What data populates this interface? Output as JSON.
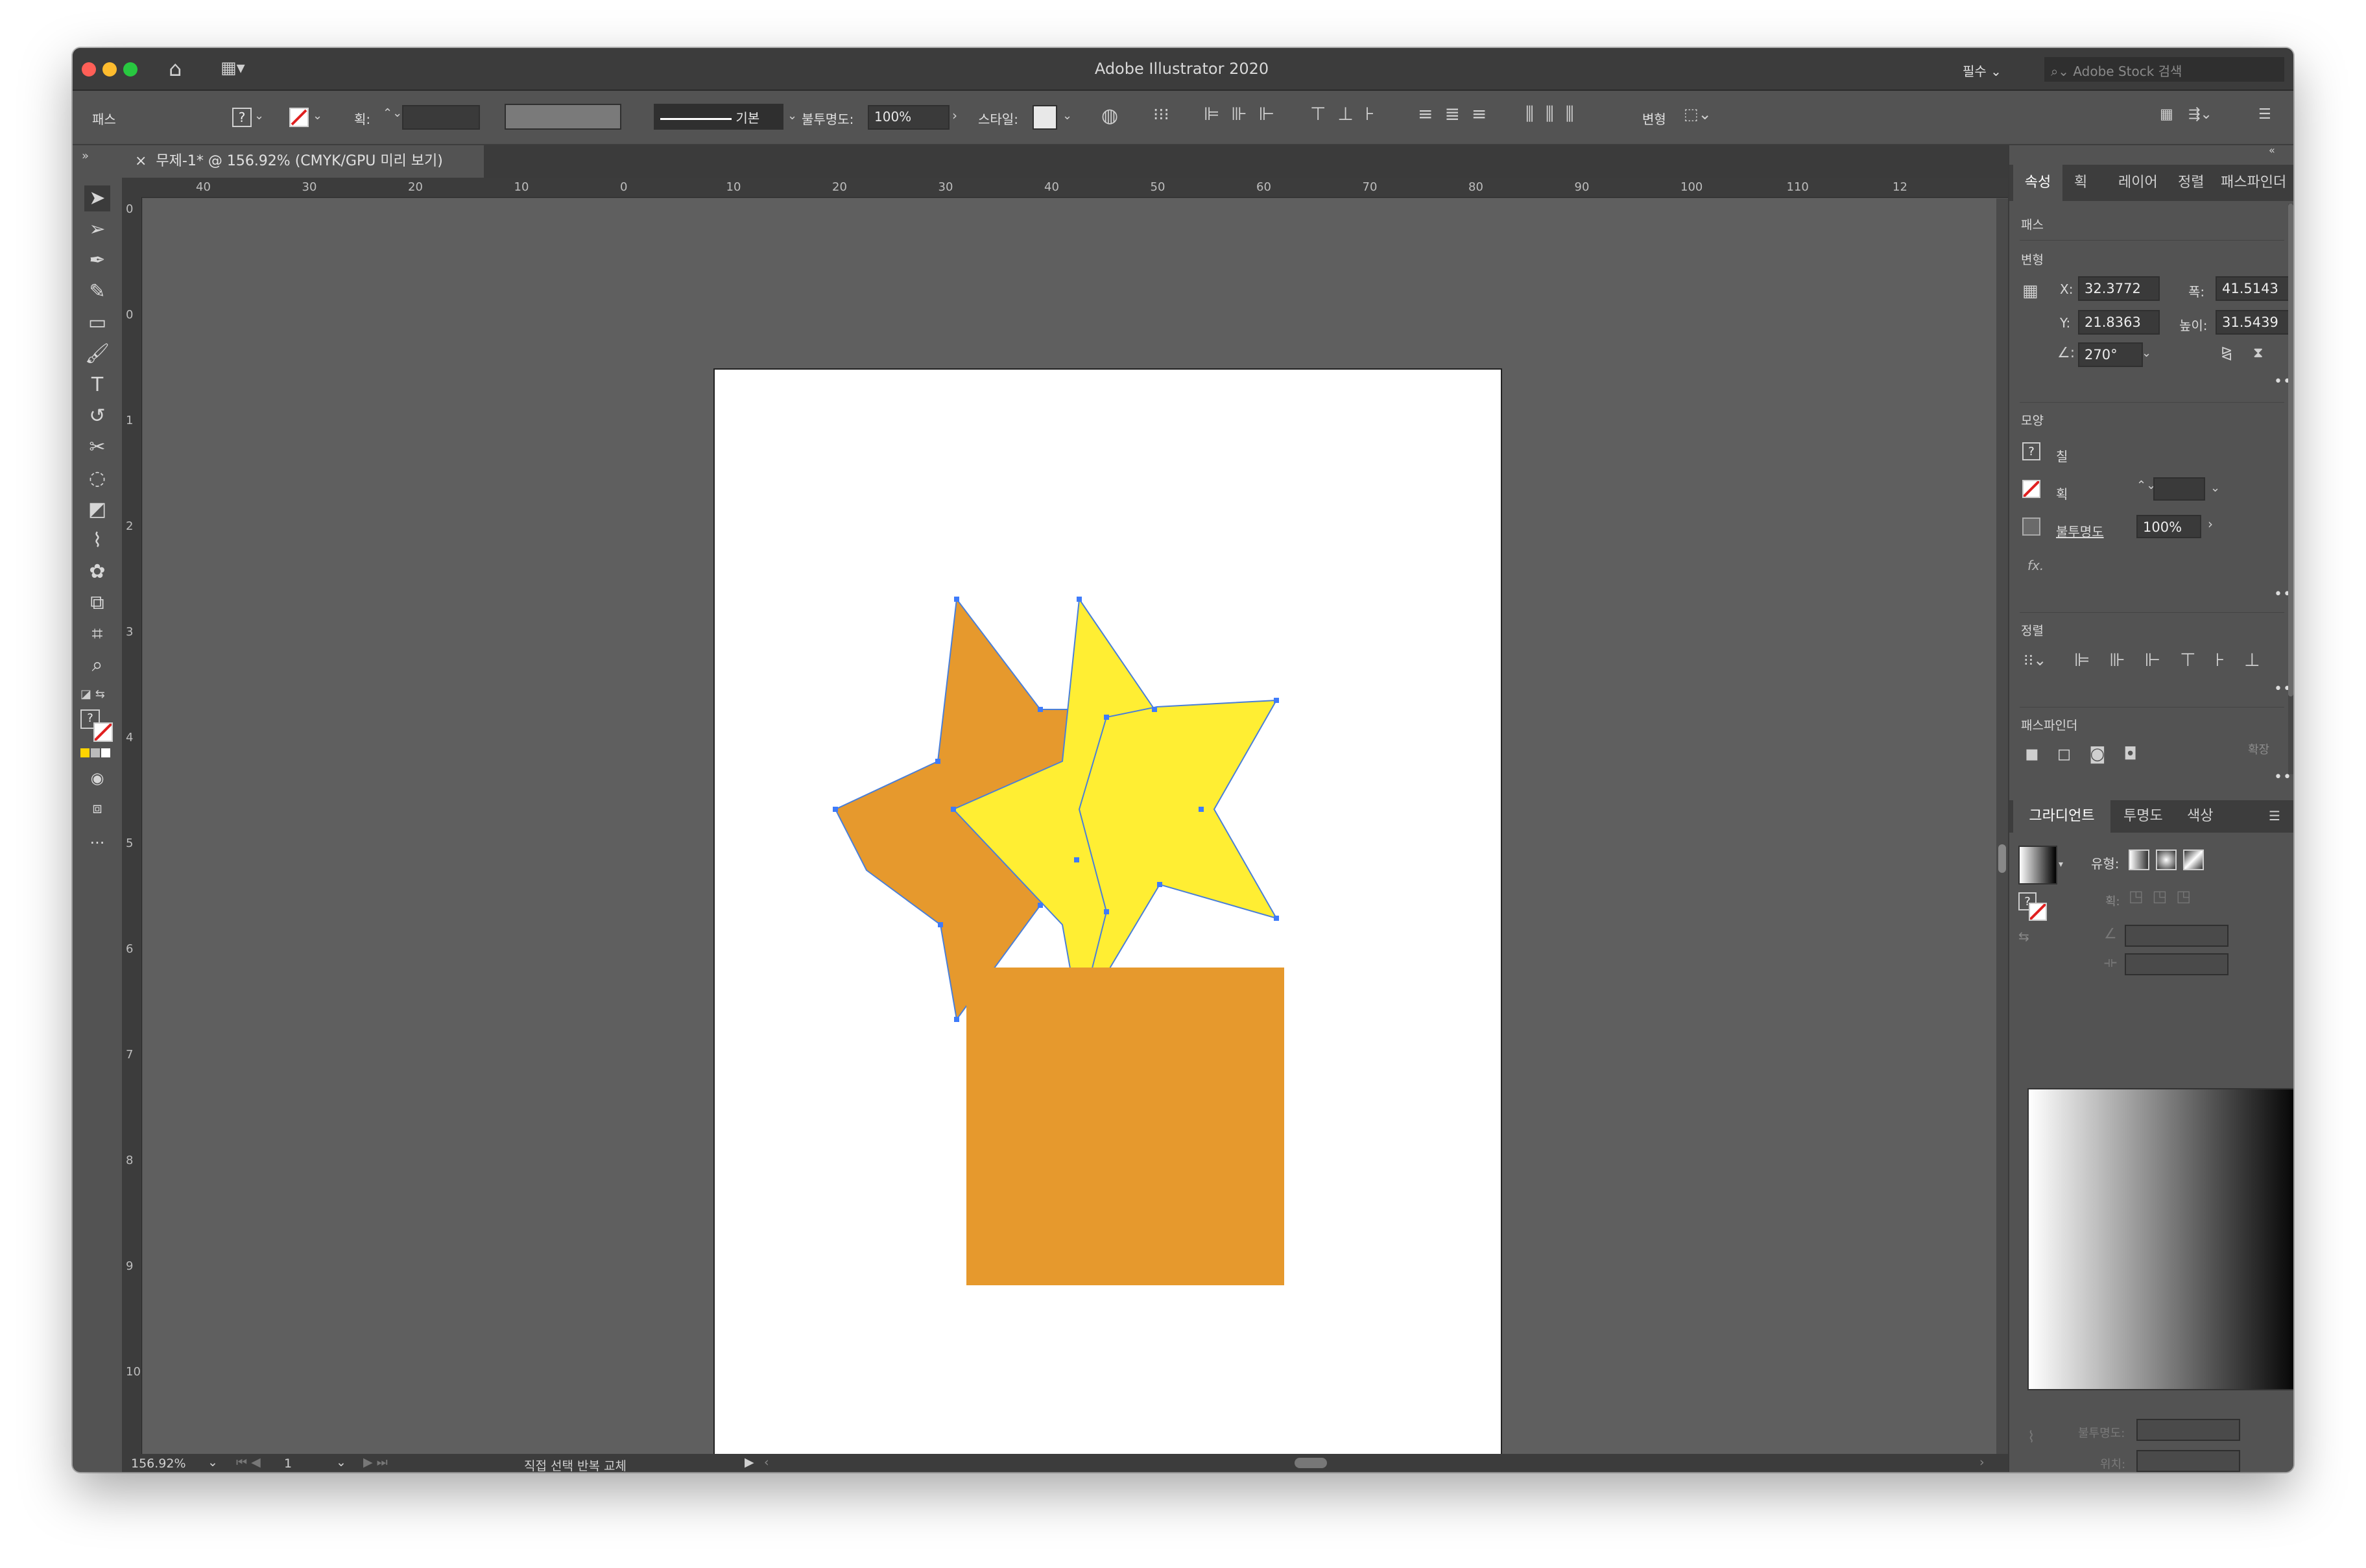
{
  "app": {
    "title": "Adobe Illustrator 2020",
    "workspace_label": "필수",
    "stock_search_placeholder": "Adobe Stock 검색"
  },
  "control_bar": {
    "object_type": "패스",
    "stroke_label": "획:",
    "stroke_profile": "기본",
    "opacity_label": "불투명도:",
    "opacity_value": "100%",
    "style_label": "스타일:",
    "transform_label": "변형"
  },
  "document_tab": {
    "title": "무제-1* @ 156.92% (CMYK/GPU 미리 보기)"
  },
  "ruler": {
    "h_labels": [
      "40",
      "30",
      "20",
      "10",
      "0",
      "10",
      "20",
      "30",
      "40",
      "50",
      "60",
      "70",
      "80",
      "90",
      "100",
      "110",
      "12"
    ],
    "v_labels": [
      "0",
      "0",
      "1",
      "2",
      "3",
      "4",
      "5",
      "6",
      "7",
      "8",
      "9",
      "10"
    ]
  },
  "status_bar": {
    "zoom": "156.92%",
    "artboard": "1",
    "status_text": "직접 선택 반복 교체"
  },
  "properties_panel": {
    "tabs": [
      "속성",
      "획",
      "레이어",
      "정렬",
      "패스파인더"
    ],
    "object_type": "패스",
    "transform": {
      "title": "변형",
      "x_label": "X:",
      "x": "32.3772",
      "y_label": "Y:",
      "y": "21.8363",
      "w_label": "폭:",
      "w": "41.5143",
      "h_label": "높이:",
      "h": "31.5439",
      "angle": "270°"
    },
    "appearance": {
      "title": "모양",
      "fill_label": "칠",
      "stroke_label": "획",
      "opacity_label": "불투명도",
      "opacity_value": "100%",
      "fx": "fx."
    },
    "align": {
      "title": "정렬"
    },
    "pathfinder": {
      "title": "패스파인더",
      "expand_label": "확장"
    }
  },
  "gradient_panel": {
    "tabs": [
      "그라디언트",
      "투명도",
      "색상"
    ],
    "type_label": "유형:",
    "stroke_label": "획:",
    "opacity_label": "불투명도:",
    "location_label": "위치:"
  },
  "transform_panel_collapsed": {
    "title": "변형"
  },
  "colors": {
    "orange": "#E6992D",
    "yellow": "#FFEE33",
    "anchor": "#3E7BFA",
    "artboard": "#FFFFFF",
    "canvas": "#5F5F5F"
  }
}
